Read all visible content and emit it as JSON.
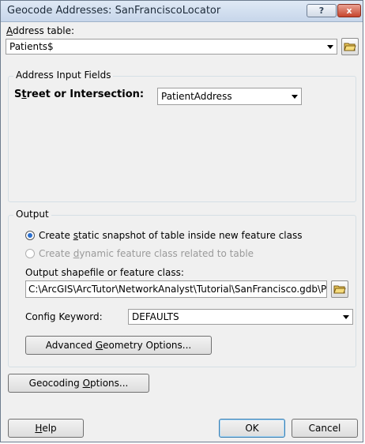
{
  "window": {
    "title": "Geocode Addresses:  SanFranciscoLocator",
    "help_glyph": "?",
    "close_glyph": "x"
  },
  "address_table": {
    "label_prefix": "",
    "label_ul": "A",
    "label_rest": "ddress table:",
    "value": "Patients$",
    "browse_icon": "open-folder-icon"
  },
  "address_input": {
    "group_title": "Address Input Fields",
    "street_label_prefix": "S",
    "street_label_ul": "t",
    "street_label_rest": "reet or Intersection:",
    "street_value": "PatientAddress"
  },
  "output": {
    "group_title": "Output",
    "radio_static_prefix": "Create ",
    "radio_static_ul": "s",
    "radio_static_rest": "tatic snapshot of table inside new feature class",
    "radio_static_selected": true,
    "radio_dynamic_prefix": "Create ",
    "radio_dynamic_ul": "d",
    "radio_dynamic_rest": "ynamic feature class related to table",
    "radio_dynamic_enabled": false,
    "shapefile_label": "Output shapefile or feature class:",
    "shapefile_value": "C:\\ArcGIS\\ArcTutor\\NetworkAnalyst\\Tutorial\\SanFrancisco.gdb\\P",
    "config_label": "Config Keyword:",
    "config_value": "DEFAULTS",
    "advanced_prefix": "Advanced ",
    "advanced_ul": "G",
    "advanced_rest": "eometry Options..."
  },
  "buttons": {
    "geocoding_prefix": "Geocoding ",
    "geocoding_ul": "O",
    "geocoding_rest": "ptions...",
    "help_ul": "H",
    "help_rest": "elp",
    "ok": "OK",
    "cancel": "Cancel"
  }
}
